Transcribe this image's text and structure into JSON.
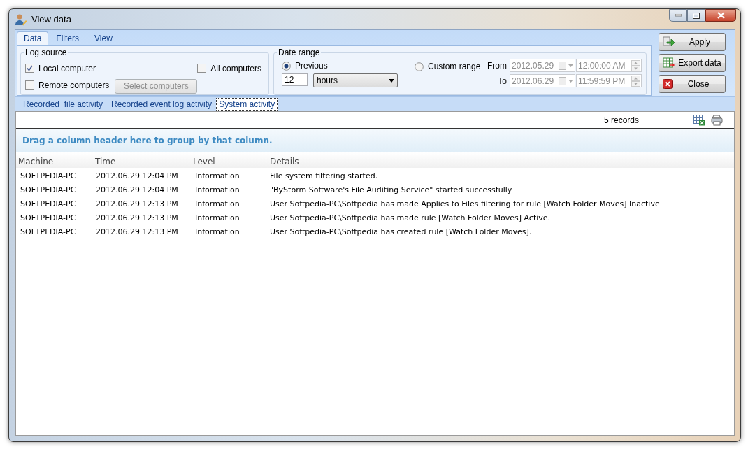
{
  "window": {
    "title": "View data"
  },
  "ribbon_tabs": [
    {
      "label": "Data",
      "selected": true
    },
    {
      "label": "Filters",
      "selected": false
    },
    {
      "label": "View",
      "selected": false
    }
  ],
  "log_source": {
    "title": "Log source",
    "options": [
      {
        "label": "Local computer",
        "checked": true
      },
      {
        "label": "Remote computers",
        "checked": false
      },
      {
        "label": "All computers",
        "checked": false
      }
    ],
    "select_button": {
      "label": "Select computers",
      "disabled": true
    }
  },
  "date_range": {
    "title": "Date range",
    "modes": [
      {
        "label": "Previous",
        "selected": true
      },
      {
        "label": "Custom range",
        "selected": false
      }
    ],
    "previous_value": "12",
    "unit": "hours",
    "fields": [
      {
        "label": "From",
        "date": "2012.05.29",
        "time": "12:00:00 AM",
        "disabled": true
      },
      {
        "label": "To",
        "date": "2012.06.29",
        "time": "11:59:59 PM",
        "disabled": true
      }
    ]
  },
  "actions": [
    {
      "kind": "apply",
      "label": "Apply"
    },
    {
      "kind": "export",
      "label": "Export data"
    },
    {
      "kind": "close",
      "label": "Close"
    }
  ],
  "view_tabs": [
    {
      "label": "Recorded  file activity",
      "selected": false
    },
    {
      "label": "Recorded event log activity",
      "selected": false
    },
    {
      "label": "System activity",
      "selected": true
    }
  ],
  "toolbar": {
    "record_count": "5 records"
  },
  "group_hint": "Drag a column header here to group by that column.",
  "table": {
    "columns": [
      "Machine",
      "Time",
      "Level",
      "Details"
    ],
    "rows": [
      [
        "SOFTPEDIA-PC",
        "2012.06.29 12:04 PM",
        "Information",
        "File system filtering started."
      ],
      [
        "SOFTPEDIA-PC",
        "2012.06.29 12:04 PM",
        "Information",
        "\"ByStorm Software's File Auditing Service\" started successfully."
      ],
      [
        "SOFTPEDIA-PC",
        "2012.06.29 12:13 PM",
        "Information",
        "User Softpedia-PC\\Softpedia has made Applies to Files filtering for rule [Watch Folder Moves] Inactive."
      ],
      [
        "SOFTPEDIA-PC",
        "2012.06.29 12:13 PM",
        "Information",
        "User Softpedia-PC\\Softpedia has made rule [Watch Folder Moves] Active."
      ],
      [
        "SOFTPEDIA-PC",
        "2012.06.29 12:13 PM",
        "Information",
        "User Softpedia-PC\\Softpedia has created rule [Watch Folder Moves]."
      ]
    ]
  }
}
